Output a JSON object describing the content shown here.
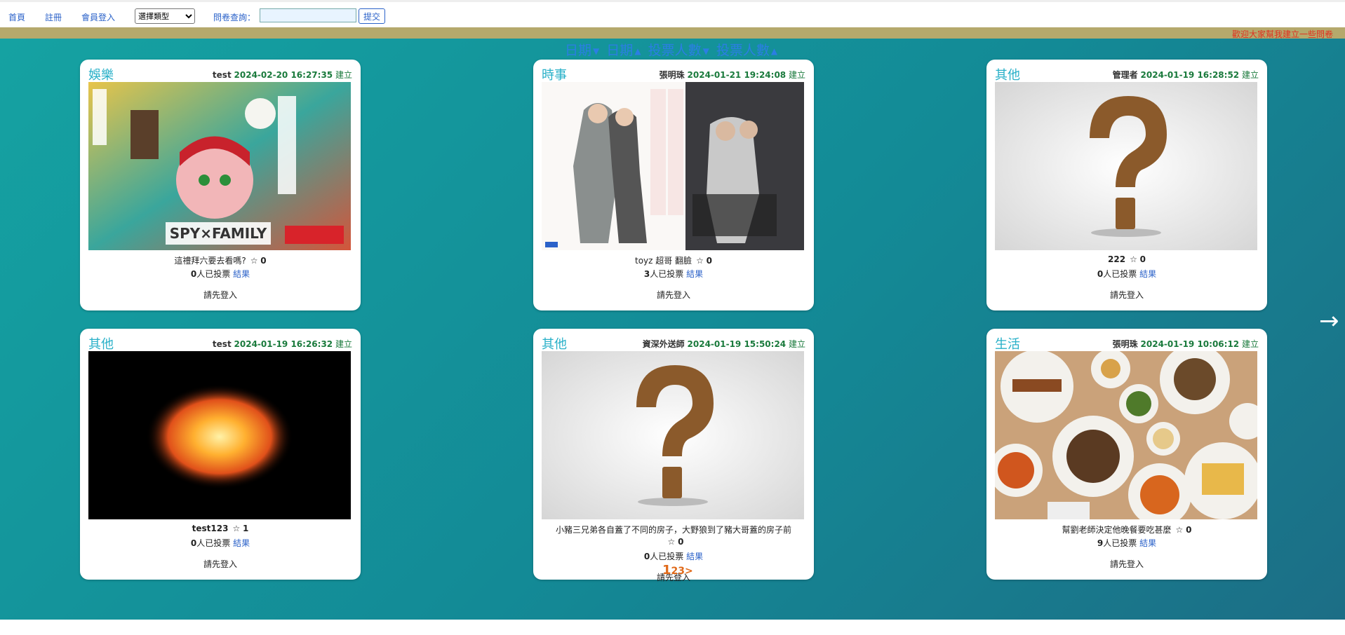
{
  "nav": {
    "home": "首頁",
    "register": "註冊",
    "login": "會員登入",
    "type_select": "選擇類型",
    "query_label": "問卷查詢：",
    "submit": "提交"
  },
  "marquee": "歡迎大家幫我建立一些問卷",
  "sort": {
    "date_desc": "日期",
    "date_asc": "日期",
    "votes_desc": "投票人數",
    "votes_asc": "投票人數",
    "icon_down": "▼",
    "icon_up": "▲"
  },
  "cards": [
    {
      "category": "娛樂",
      "author": "test",
      "date": "2024-02-20 16:27:35",
      "created": "建立",
      "title": "這禮拜六要去看嗎?",
      "stars": "0",
      "voters": "0",
      "voted_suffix": "人已投票",
      "result": "結果",
      "login": "請先登入",
      "image": "anime-poster"
    },
    {
      "category": "時事",
      "author": "張明珠",
      "date": "2024-01-21 19:24:08",
      "created": "建立",
      "title": "toyz 超哥 翻臉",
      "stars": "0",
      "voters": "3",
      "voted_suffix": "人已投票",
      "result": "結果",
      "login": "請先登入",
      "image": "news-poster"
    },
    {
      "category": "其他",
      "author": "管理者",
      "date": "2024-01-19 16:28:52",
      "created": "建立",
      "title": "222",
      "stars": "0",
      "voters": "0",
      "voted_suffix": "人已投票",
      "result": "結果",
      "login": "請先登入",
      "image": "question-mark"
    },
    {
      "category": "其他",
      "author": "test",
      "date": "2024-01-19 16:26:32",
      "created": "建立",
      "title": "test123",
      "stars": "1",
      "voters": "0",
      "voted_suffix": "人已投票",
      "result": "結果",
      "login": "請先登入",
      "image": "fireball"
    },
    {
      "category": "其他",
      "author": "資深外送師",
      "date": "2024-01-19 15:50:24",
      "created": "建立",
      "title": "小豬三兄弟各自蓋了不同的房子，大野狼到了豬大哥蓋的房子前",
      "stars": "0",
      "voters": "0",
      "voted_suffix": "人已投票",
      "result": "結果",
      "login": "請先登入",
      "image": "question-mark"
    },
    {
      "category": "生活",
      "author": "張明珠",
      "date": "2024-01-19 10:06:12",
      "created": "建立",
      "title": "幫劉老師決定他晚餐要吃甚麼",
      "stars": "0",
      "voters": "9",
      "voted_suffix": "人已投票",
      "result": "結果",
      "login": "請先登入",
      "image": "food-platter"
    }
  ],
  "pager": {
    "p1": "1",
    "p2": "2",
    "p3": "3",
    "next": ">"
  },
  "next_arrow": "→"
}
